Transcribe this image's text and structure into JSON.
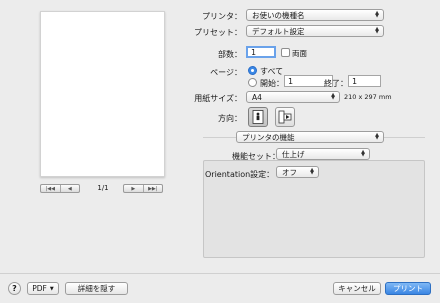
{
  "preview": {
    "page_indicator": "1/1",
    "nav_first": "|◀◀",
    "nav_prev": "◀",
    "nav_next": "▶",
    "nav_last": "▶▶|"
  },
  "printer": {
    "label": "プリンタ：",
    "value": "お使いの機種名"
  },
  "presets": {
    "label": "プリセット：",
    "value": "デフォルト設定"
  },
  "copies": {
    "label": "部数：",
    "value": "1",
    "two_sided_label": "両面"
  },
  "pages": {
    "label": "ページ：",
    "all_label": "すべて",
    "from_label": "開始：",
    "from_value": "1",
    "to_label": "終了：",
    "to_value": "1",
    "selected": "all"
  },
  "paper_size": {
    "label": "用紙サイズ：",
    "value": "A4",
    "dimensions": "210 x 297 mm"
  },
  "orientation": {
    "label": "方向：",
    "selected": "portrait"
  },
  "section_popup": {
    "value": "プリンタの機能"
  },
  "feature_set": {
    "label": "機能セット：",
    "value": "仕上げ"
  },
  "orientation_setting": {
    "label": "Orientation設定：",
    "value": "オフ"
  },
  "footer": {
    "help": "?",
    "pdf": "PDF",
    "hide_details": "詳細を隠す",
    "cancel": "キャンセル",
    "print": "プリント"
  }
}
